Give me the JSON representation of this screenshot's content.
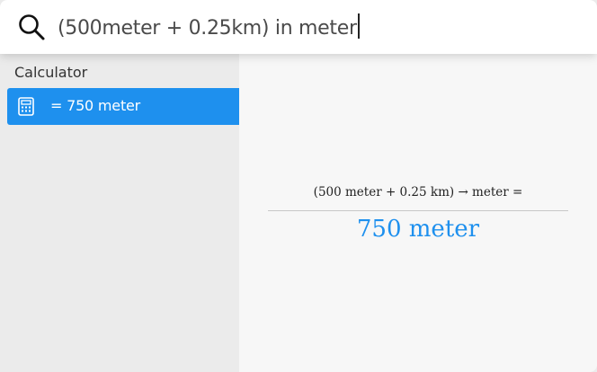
{
  "search": {
    "query": "(500meter + 0.25km) in meter"
  },
  "sidebar": {
    "section_title": "Calculator",
    "results": [
      {
        "label": "= 750 meter",
        "icon": "calculator-icon"
      }
    ]
  },
  "main": {
    "expression": "(500 meter + 0.25 km) → meter =",
    "answer": "750 meter"
  },
  "colors": {
    "accent": "#1e90ee",
    "sidebar_bg": "#ebebeb",
    "main_bg": "#f7f7f7"
  }
}
